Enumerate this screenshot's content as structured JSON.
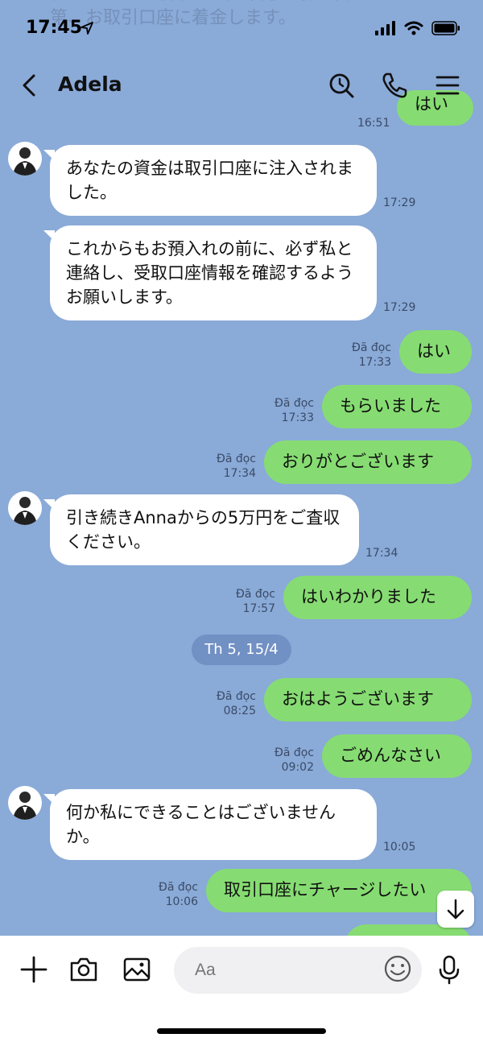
{
  "status": {
    "time": "17:45"
  },
  "header": {
    "title": "Adela"
  },
  "ghost_text": "グラウンドに渡します。確認が取れ次第、お取引口座に着金します。",
  "top_partial": {
    "label": "はい",
    "time": "16:51"
  },
  "messages": [
    {
      "text": "あなたの資金は取引口座に注入されました。",
      "time": "17:29"
    },
    {
      "text": "これからもお預入れの前に、必ず私と連絡し、受取口座情報を確認するようお願いします。",
      "time": "17:29"
    },
    {
      "text": "はい",
      "status": "Đã đọc",
      "time": "17:33"
    },
    {
      "text": "もらいました",
      "status": "Đã đọc",
      "time": "17:33"
    },
    {
      "text": "おりがとございます",
      "status": "Đã đọc",
      "time": "17:34"
    },
    {
      "text": "引き続きAnnaからの5万円をご査収ください。",
      "time": "17:34"
    },
    {
      "text": "はいわかりました",
      "status": "Đã đọc",
      "time": "17:57"
    },
    {
      "text": "おはようございます",
      "status": "Đã đọc",
      "time": "08:25"
    },
    {
      "text": "ごめんなさい",
      "status": "Đã đọc",
      "time": "09:02"
    },
    {
      "text": "何か私にできることはございませんか。",
      "time": "10:05"
    },
    {
      "text": "取引口座にチャージしたい",
      "status": "Đã đọc",
      "time": "10:06"
    }
  ],
  "date_separator": "Th 5, 15/4",
  "composer": {
    "placeholder": "Aa"
  },
  "icons": [
    "location-arrow-icon",
    "signal-icon",
    "wifi-icon",
    "battery-icon",
    "back-chevron-icon",
    "search-icon",
    "phone-icon",
    "menu-icon",
    "plus-icon",
    "camera-icon",
    "image-icon",
    "emoji-icon",
    "microphone-icon",
    "arrow-down-icon"
  ],
  "colors": {
    "background": "#8aaad8",
    "outgoing_bubble": "#86dc72",
    "incoming_bubble": "#ffffff",
    "date_pill": "#7190c4"
  }
}
